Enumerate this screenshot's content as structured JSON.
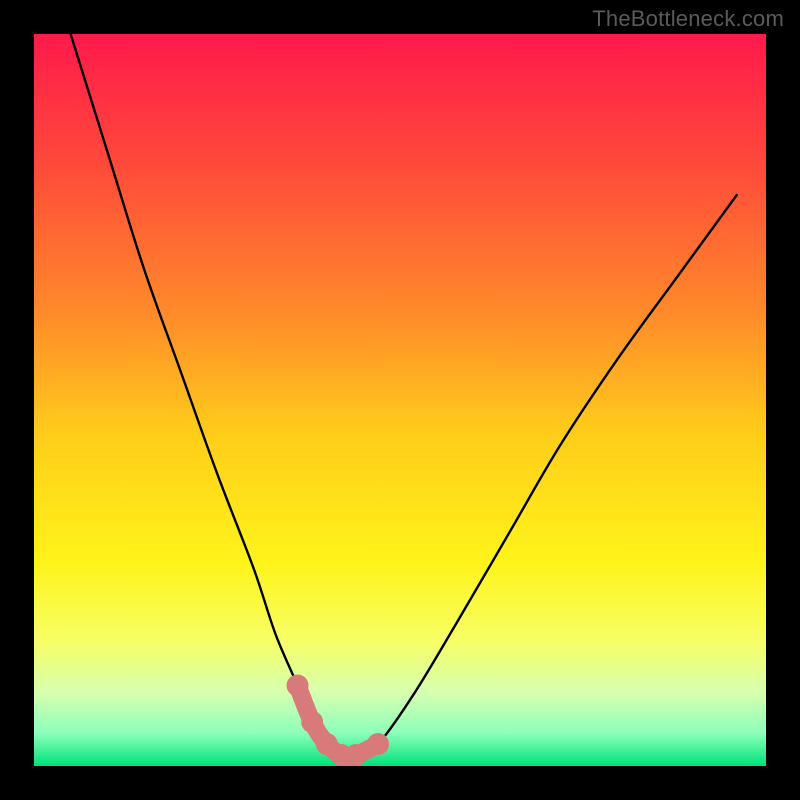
{
  "watermark": "TheBottleneck.com",
  "chart_data": {
    "type": "line",
    "title": "",
    "xlabel": "",
    "ylabel": "",
    "xlim": [
      0,
      100
    ],
    "ylim": [
      0,
      100
    ],
    "series": [
      {
        "name": "bottleneck-curve",
        "x": [
          5,
          10,
          15,
          20,
          25,
          30,
          33,
          36,
          38,
          40,
          42,
          44,
          47,
          52,
          58,
          65,
          72,
          80,
          88,
          96
        ],
        "y": [
          100,
          84,
          68,
          54,
          40,
          27,
          18,
          11,
          6,
          3,
          1.5,
          1.5,
          3,
          10,
          20,
          32,
          44,
          56,
          67,
          78
        ]
      }
    ],
    "highlight_region": {
      "name": "optimal-zone",
      "x": [
        36,
        38,
        40,
        42,
        44,
        47
      ],
      "y": [
        11,
        6,
        3,
        1.5,
        1.5,
        3
      ]
    },
    "gradient_stops": [
      {
        "pos": 0.0,
        "color": "#ff1a4b"
      },
      {
        "pos": 0.18,
        "color": "#ff4a3a"
      },
      {
        "pos": 0.38,
        "color": "#ff8a2a"
      },
      {
        "pos": 0.55,
        "color": "#ffce1a"
      },
      {
        "pos": 0.72,
        "color": "#fff31a"
      },
      {
        "pos": 0.83,
        "color": "#f6ff66"
      },
      {
        "pos": 0.9,
        "color": "#d6ffb0"
      },
      {
        "pos": 0.955,
        "color": "#8cffba"
      },
      {
        "pos": 1.0,
        "color": "#00e27a"
      }
    ],
    "colors": {
      "curve": "#000000",
      "highlight": "#d97a7a",
      "frame": "#000000"
    }
  }
}
